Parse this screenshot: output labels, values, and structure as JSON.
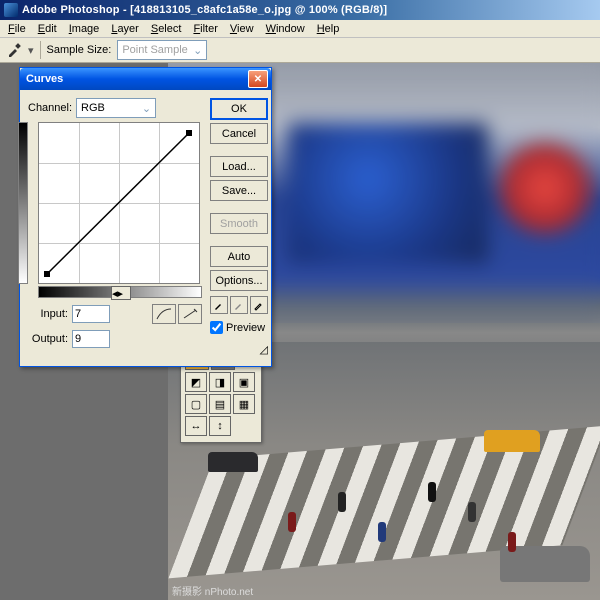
{
  "titlebar": {
    "text": "Adobe Photoshop - [418813105_c8afc1a58e_o.jpg @ 100% (RGB/8)]"
  },
  "menu": {
    "items": [
      "File",
      "Edit",
      "Image",
      "Layer",
      "Select",
      "Filter",
      "View",
      "Window",
      "Help"
    ]
  },
  "options": {
    "sample_label": "Sample Size:",
    "sample_value": "Point Sample"
  },
  "dialog": {
    "title": "Curves",
    "channel_label": "Channel:",
    "channel_value": "RGB",
    "input_label": "Input:",
    "input_value": "7",
    "output_label": "Output:",
    "output_value": "9",
    "ok": "OK",
    "cancel": "Cancel",
    "load": "Load...",
    "save": "Save...",
    "smooth": "Smooth",
    "auto": "Auto",
    "options": "Options...",
    "preview_label": "Preview",
    "preview_checked": true
  },
  "chart_data": {
    "type": "line",
    "title": "Curves",
    "xlabel": "Input",
    "ylabel": "Output",
    "xlim": [
      0,
      255
    ],
    "ylim": [
      0,
      255
    ],
    "series": [
      {
        "name": "RGB",
        "x": [
          7,
          248
        ],
        "y": [
          9,
          250
        ]
      }
    ],
    "grid": true
  },
  "watermark": "新摄影 nPhoto.net"
}
